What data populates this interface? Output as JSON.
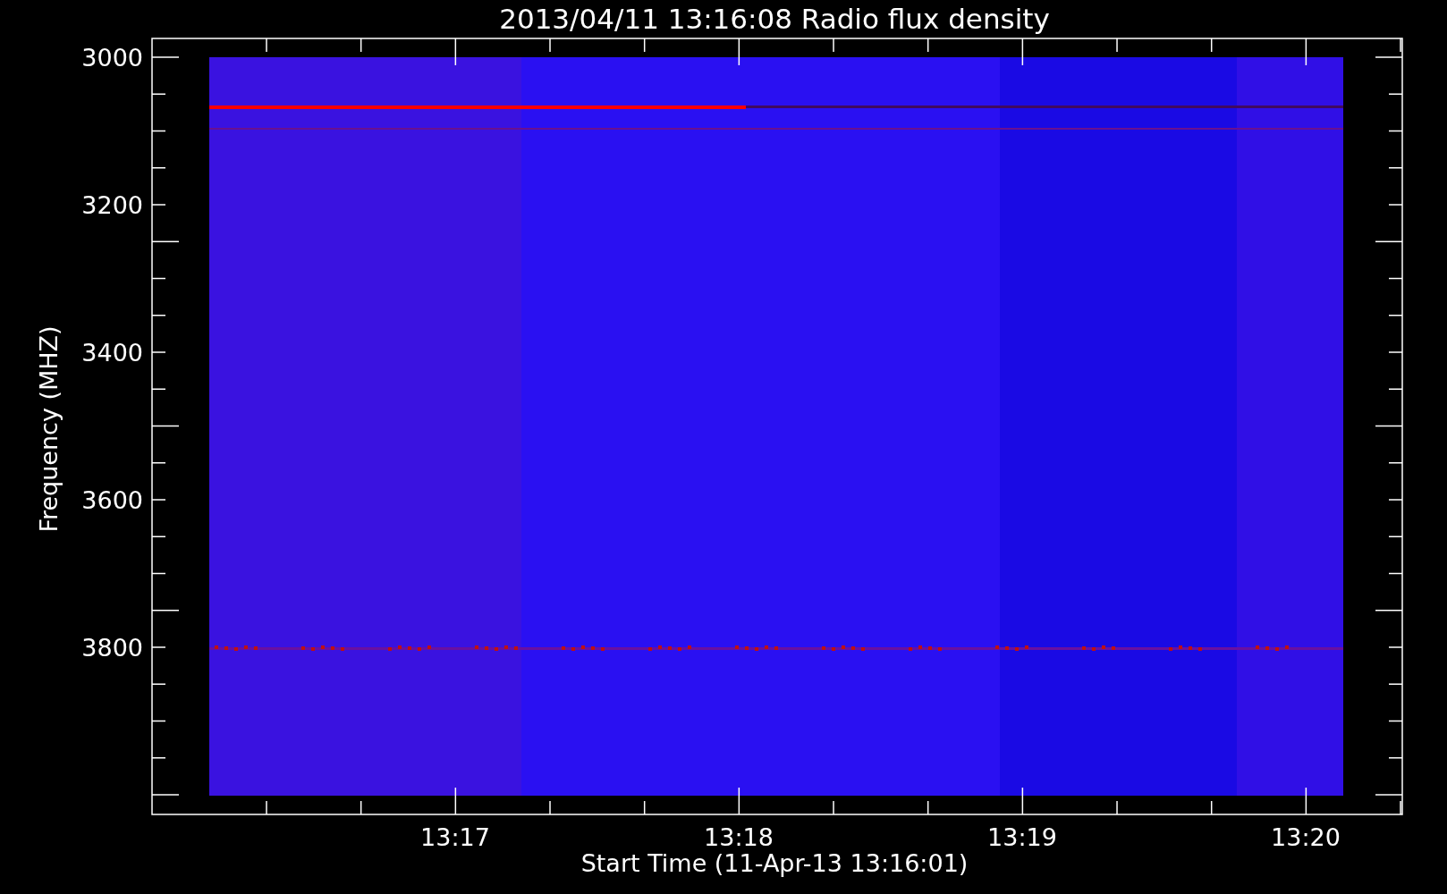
{
  "title": "2013/04/11 13:16:08 Radio flux density",
  "y_axis": {
    "label": "Frequency (MHZ)",
    "ticks": [
      "3000",
      "3200",
      "3400",
      "3600",
      "3800"
    ]
  },
  "x_axis": {
    "label": "Start Time (11-Apr-13 13:16:01)",
    "ticks": [
      "13:17",
      "13:18",
      "13:19",
      "13:20"
    ]
  }
}
